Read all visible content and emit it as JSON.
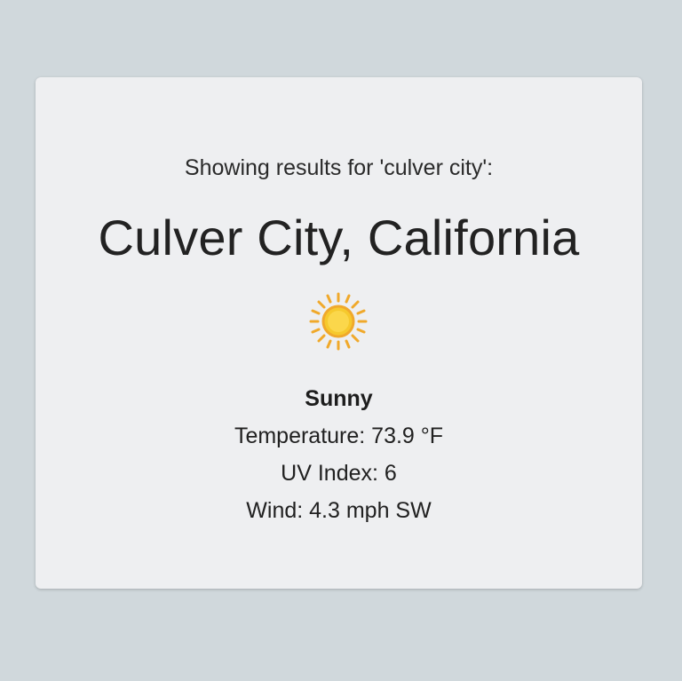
{
  "query_text": "Showing results for 'culver city':",
  "location": "Culver City, California",
  "weather": {
    "icon": "sun-icon",
    "condition": "Sunny",
    "temperature": "Temperature: 73.9 °F",
    "uv_index": "UV Index: 6",
    "wind": "Wind: 4.3 mph SW"
  },
  "colors": {
    "background": "#d0d8dc",
    "card": "#eeeff1",
    "sun_core": "#f6c92d",
    "sun_rays": "#f0a92b"
  }
}
